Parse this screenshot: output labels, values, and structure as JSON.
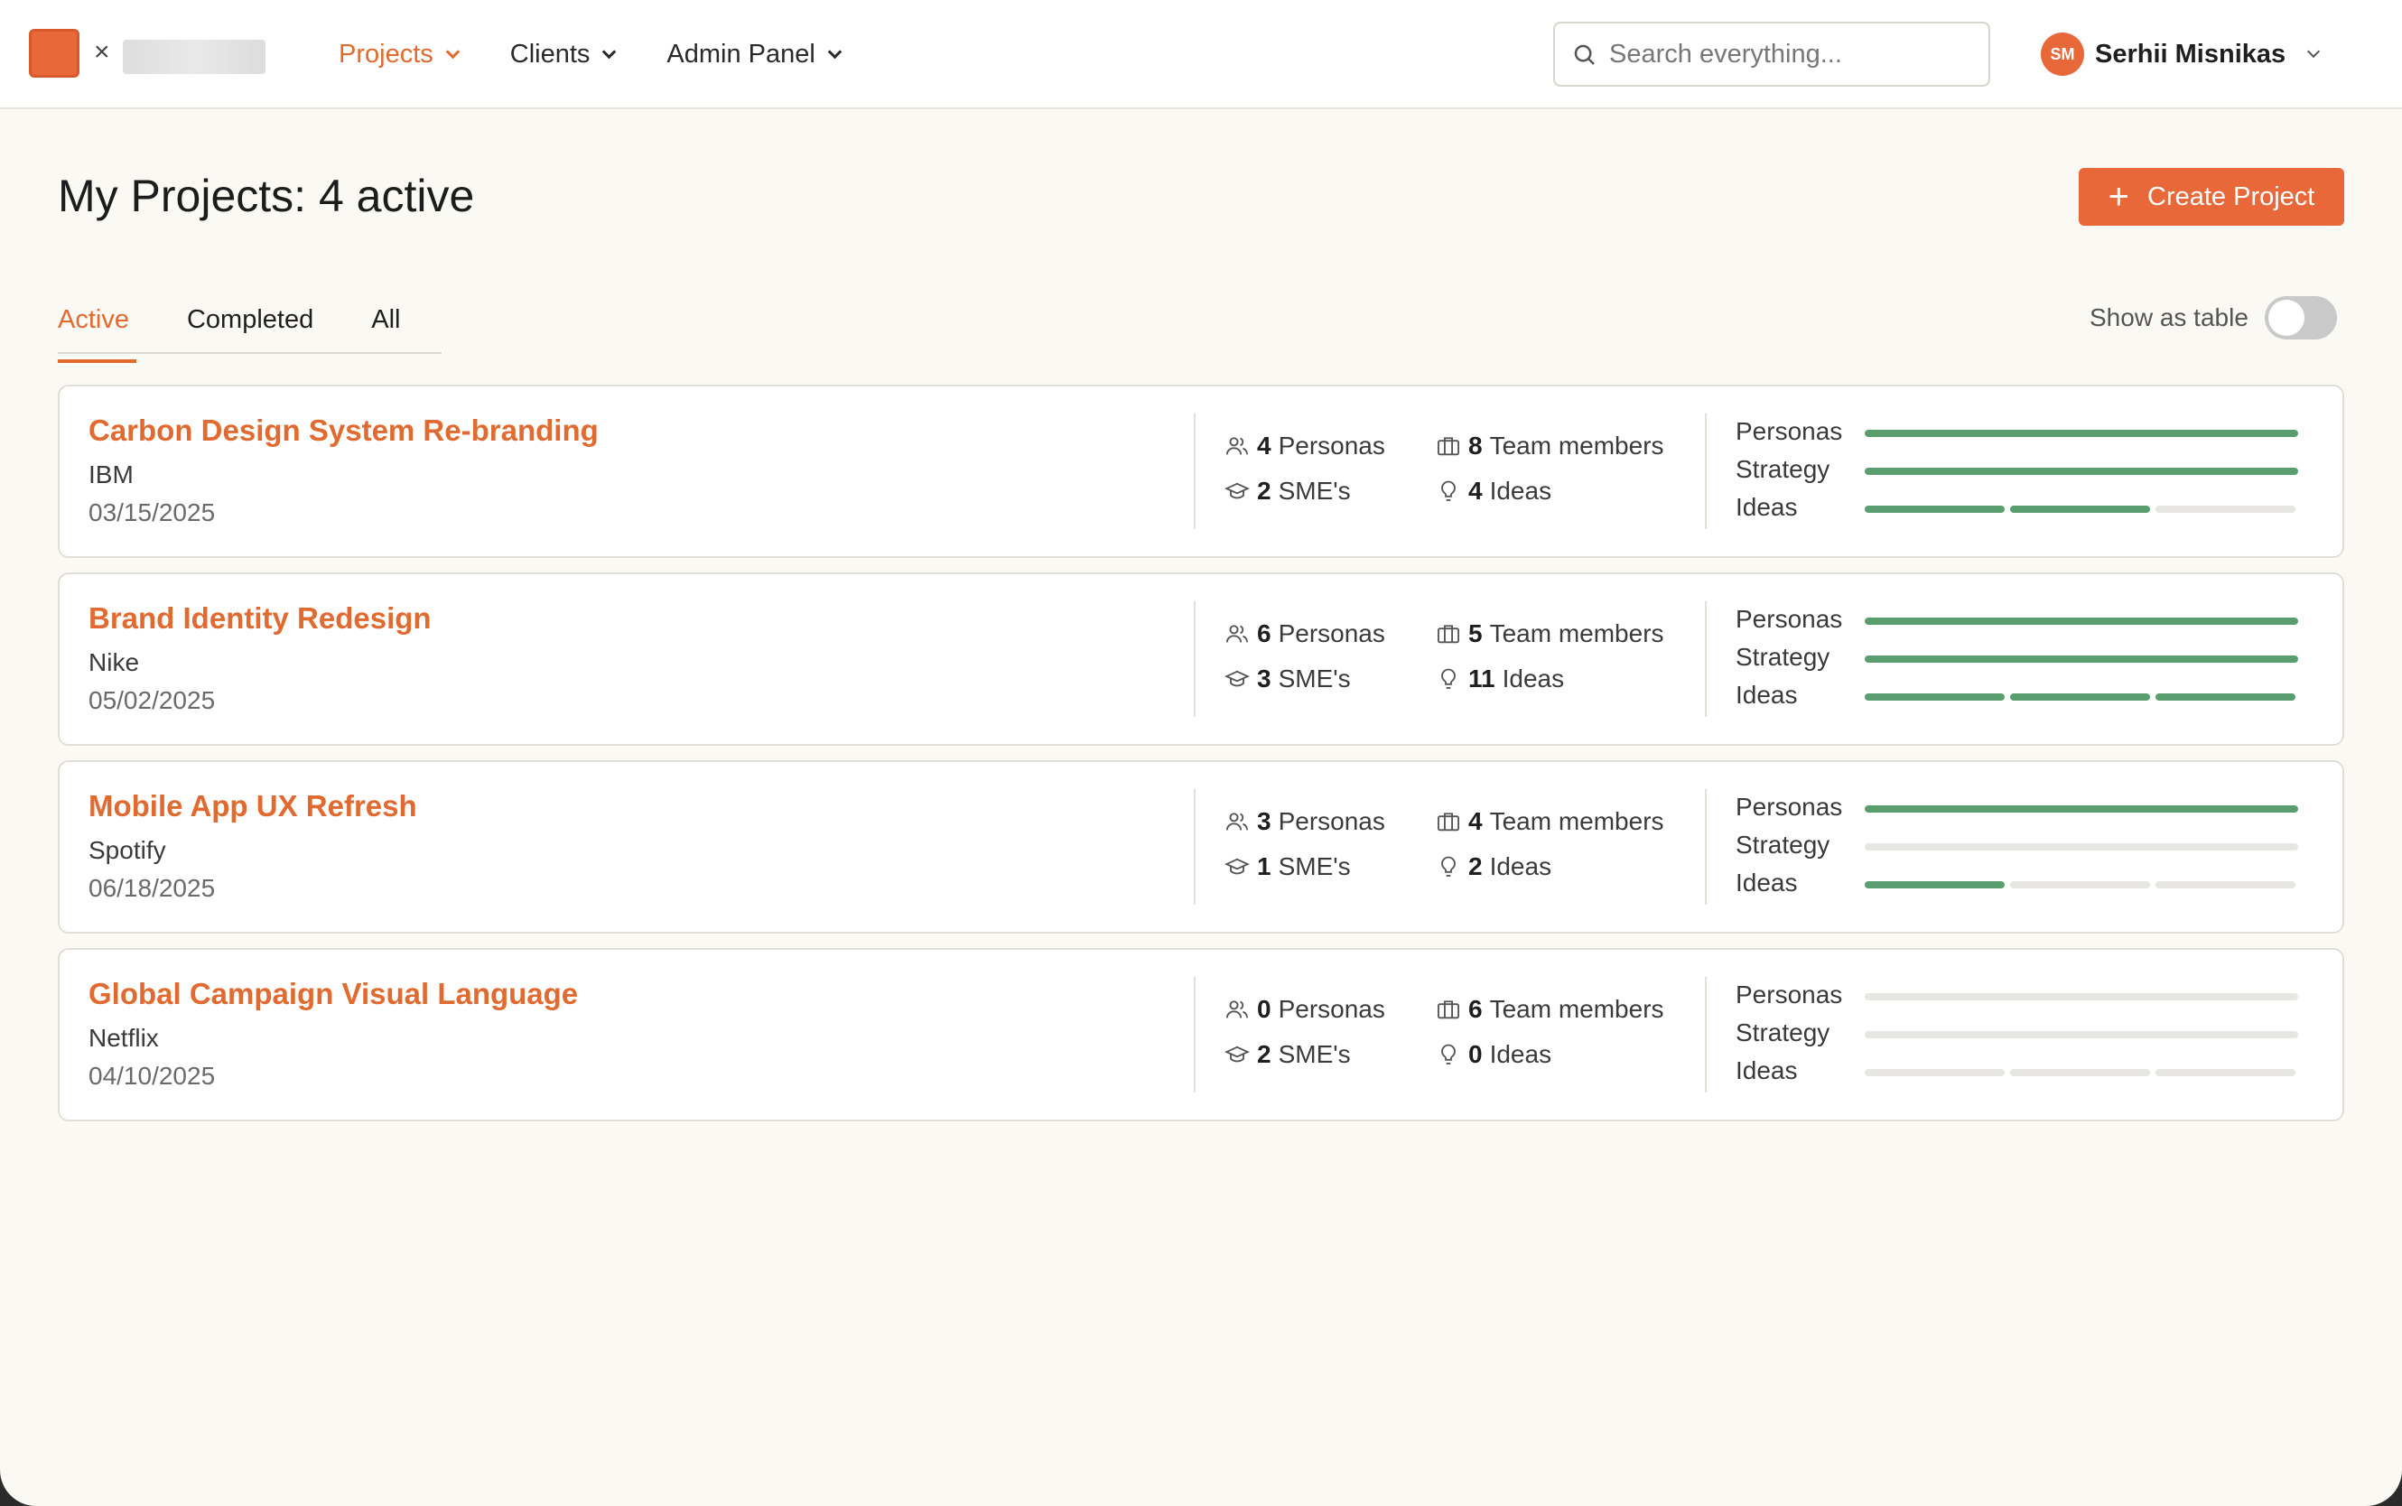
{
  "header": {
    "brand_close": "×",
    "nav": [
      {
        "label": "Projects",
        "active": true
      },
      {
        "label": "Clients",
        "active": false
      },
      {
        "label": "Admin Panel",
        "active": false
      }
    ],
    "search": {
      "placeholder": "Search everything..."
    },
    "user": {
      "initials": "SM",
      "name": "Serhii Misnikas"
    }
  },
  "page": {
    "title": "My Projects: 4 active",
    "create_label": "Create Project",
    "create_icon": "+",
    "tabs": [
      {
        "label": "Active",
        "active": true
      },
      {
        "label": "Completed",
        "active": false
      },
      {
        "label": "All",
        "active": false
      }
    ],
    "toggle_label": "Show as table",
    "toggle_on": false
  },
  "progress_labels": [
    "Personas",
    "Strategy",
    "Ideas"
  ],
  "stat_labels": {
    "personas": "Personas",
    "smes": "SME's",
    "team": "Team members",
    "ideas": "Ideas"
  },
  "projects": [
    {
      "title": "Carbon Design System Re-branding",
      "client": "IBM",
      "date": "03/15/2025",
      "personas": "4",
      "smes": "2",
      "team": "8",
      "ideas": "4",
      "progress": {
        "personas": 1,
        "strategy": 1,
        "ideas_segments": [
          1,
          1,
          0
        ]
      }
    },
    {
      "title": "Brand Identity Redesign",
      "client": "Nike",
      "date": "05/02/2025",
      "personas": "6",
      "smes": "3",
      "team": "5",
      "ideas": "11",
      "progress": {
        "personas": 1,
        "strategy": 1,
        "ideas_segments": [
          1,
          1,
          1
        ]
      }
    },
    {
      "title": "Mobile App UX Refresh",
      "client": "Spotify",
      "date": "06/18/2025",
      "personas": "3",
      "smes": "1",
      "team": "4",
      "ideas": "2",
      "progress": {
        "personas": 1,
        "strategy": 0,
        "ideas_segments": [
          1,
          0,
          0
        ]
      }
    },
    {
      "title": "Global Campaign Visual Language",
      "client": "Netflix",
      "date": "04/10/2025",
      "personas": "0",
      "smes": "2",
      "team": "6",
      "ideas": "0",
      "progress": {
        "personas": 0,
        "strategy": 0,
        "ideas_segments": [
          0,
          0,
          0
        ]
      }
    }
  ],
  "colors": {
    "accent": "#e8683a",
    "progress_on": "#5a9e6f",
    "progress_off": "#e8e6e2",
    "background": "#fbf9f3"
  }
}
